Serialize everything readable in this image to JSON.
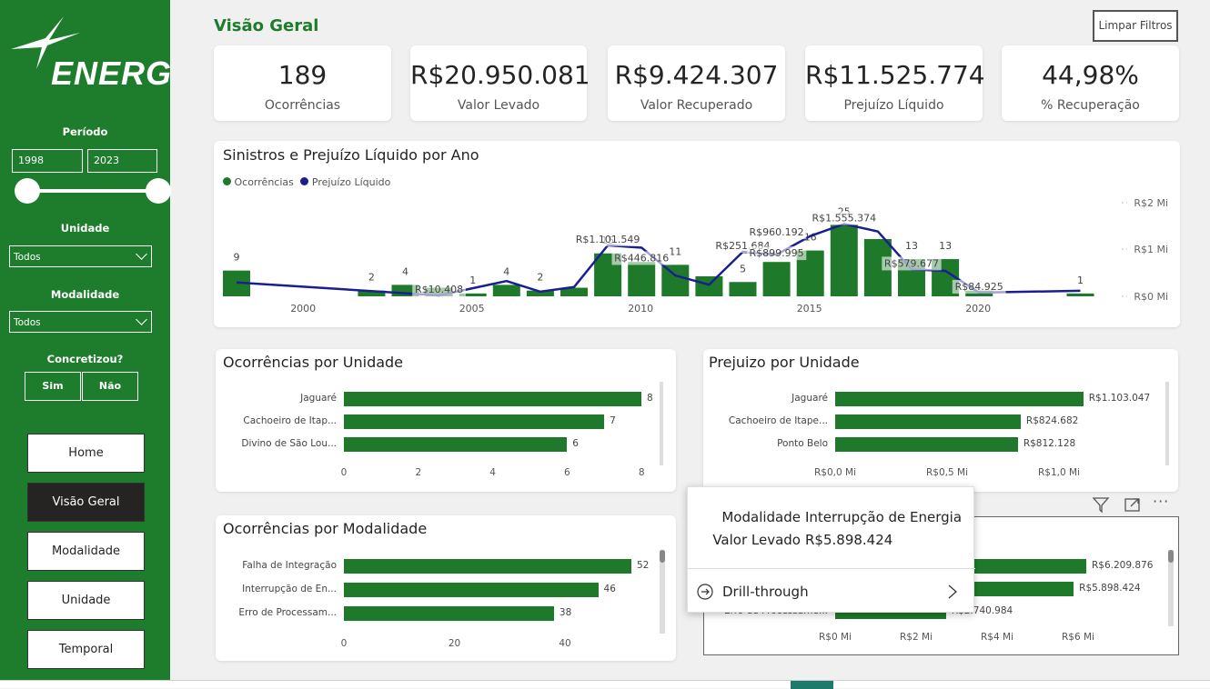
{
  "sidebar": {
    "logo": "ENERG",
    "periodo_label": "Período",
    "year_from": "1998",
    "year_to": "2023",
    "unidade_label": "Unidade",
    "unidade_value": "Todos",
    "modalidade_label": "Modalidade",
    "modalidade_value": "Todos",
    "concretizou_label": "Concretizou?",
    "sim": "Sim",
    "nao": "Não",
    "nav": [
      "Home",
      "Visão Geral",
      "Modalidade",
      "Unidade",
      "Temporal"
    ]
  },
  "header": {
    "title": "Visão Geral",
    "clear_filters": "Limpar Filtros"
  },
  "kpis": [
    {
      "value": "189",
      "label": "Ocorrências"
    },
    {
      "value": "R$20.950.081",
      "label": "Valor Levado"
    },
    {
      "value": "R$9.424.307",
      "label": "Valor Recuperado"
    },
    {
      "value": "R$11.525.774",
      "label": "Prejuízo Líquido"
    },
    {
      "value": "44,98%",
      "label": "% Recuperação"
    }
  ],
  "colors": {
    "green": "#1e7a2a",
    "navy": "#1a1f8f"
  },
  "chart_data": [
    {
      "type": "bar",
      "title": "Sinistros e Prejuízo Líquido por Ano",
      "legend": [
        "Ocorrências",
        "Prejuízo Líquido"
      ],
      "x_ticks": [
        "2000",
        "2005",
        "2010",
        "2015",
        "2020"
      ],
      "y2_ticks": [
        "R$2 Mi",
        "R$1 Mi",
        "R$0 Mi"
      ],
      "series": [
        {
          "name": "Ocorrências",
          "points": [
            [
              1998,
              9
            ],
            [
              2002,
              2
            ],
            [
              2003,
              4
            ],
            [
              2004,
              3
            ],
            [
              2005,
              1
            ],
            [
              2006,
              4
            ],
            [
              2007,
              2
            ],
            [
              2008,
              3
            ],
            [
              2009,
              15
            ],
            [
              2010,
              12
            ],
            [
              2011,
              11
            ],
            [
              2012,
              7
            ],
            [
              2013,
              5
            ],
            [
              2014,
              12
            ],
            [
              2015,
              16
            ],
            [
              2016,
              25
            ],
            [
              2017,
              20
            ],
            [
              2018,
              13
            ],
            [
              2019,
              13
            ],
            [
              2020,
              2
            ],
            [
              2023,
              1
            ]
          ]
        },
        {
          "name": "Prejuízo Líquido",
          "points": [
            [
              1998,
              0.3
            ],
            [
              2004,
              0.02
            ],
            [
              2006,
              0.33
            ],
            [
              2007,
              0.1
            ],
            [
              2008,
              0.2
            ],
            [
              2009,
              1.1
            ],
            [
              2010,
              1.05
            ],
            [
              2011,
              0.45
            ],
            [
              2012,
              0.25
            ],
            [
              2013,
              0.96
            ],
            [
              2014,
              0.9
            ],
            [
              2015,
              1.3
            ],
            [
              2016,
              1.56
            ],
            [
              2017,
              1.4
            ],
            [
              2018,
              0.58
            ],
            [
              2019,
              0.55
            ],
            [
              2020,
              0.08
            ],
            [
              2023,
              0.12
            ]
          ]
        }
      ],
      "bar_labels": [
        {
          "year": 1998,
          "text": "9"
        },
        {
          "year": 2002,
          "text": "2"
        },
        {
          "year": 2003,
          "text": "4"
        },
        {
          "year": 2005,
          "text": "1"
        },
        {
          "year": 2006,
          "text": "4"
        },
        {
          "year": 2007,
          "text": "2"
        },
        {
          "year": 2009,
          "text": "15"
        },
        {
          "year": 2011,
          "text": "11"
        },
        {
          "year": 2013,
          "text": "5"
        },
        {
          "year": 2015,
          "text": "16"
        },
        {
          "year": 2016,
          "text": "25"
        },
        {
          "year": 2018,
          "text": "13"
        },
        {
          "year": 2019,
          "text": "13"
        },
        {
          "year": 2023,
          "text": "1"
        }
      ],
      "line_labels": [
        {
          "year": 2004,
          "text": "R$10.408"
        },
        {
          "year": 2009,
          "text": "R$1.101.549"
        },
        {
          "year": 2010,
          "text": "R$446.816"
        },
        {
          "year": 2013,
          "text": "R$251.684"
        },
        {
          "year": 2014,
          "text": "R$960.192"
        },
        {
          "year": 2014,
          "text": "R$899.995"
        },
        {
          "year": 2016,
          "text": "R$1.555.374"
        },
        {
          "year": 2018,
          "text": "R$579.677"
        },
        {
          "year": 2020,
          "text": "R$84.925"
        }
      ]
    },
    {
      "type": "bar",
      "title": "Ocorrências por Unidade",
      "categories": [
        "Jaguaré",
        "Cachoeiro de Itap...",
        "Divino de São Lou..."
      ],
      "values": [
        8,
        7,
        6
      ],
      "xlim": [
        0,
        8
      ],
      "ticks": [
        "0",
        "2",
        "4",
        "6",
        "8"
      ]
    },
    {
      "type": "bar",
      "title": "Prejuizo por Unidade",
      "categories": [
        "Jaguaré",
        "Cachoeiro de Itape...",
        "Ponto Belo"
      ],
      "values": [
        1103047,
        824682,
        812128
      ],
      "value_labels": [
        "R$1.103.047",
        "R$824.682",
        "R$812.128"
      ],
      "xlim": [
        0,
        1100000
      ],
      "ticks": [
        "R$0,0 Mi",
        "R$0,5 Mi",
        "R$1,0 Mi"
      ]
    },
    {
      "type": "bar",
      "title": "Ocorrências por Modalidade",
      "categories": [
        "Falha de Integração",
        "Interrupção de En...",
        "Erro de Processam..."
      ],
      "values": [
        52,
        46,
        38
      ],
      "xlim": [
        0,
        52
      ],
      "ticks": [
        "0",
        "20",
        "40"
      ]
    },
    {
      "type": "bar",
      "title": "",
      "categories": [
        "",
        "",
        "Erro de Processame..."
      ],
      "values": [
        6209876,
        5898424,
        2740984
      ],
      "value_labels": [
        "R$6.209.876",
        "R$5.898.424",
        "R$2.740.984"
      ],
      "xlim": [
        0,
        6209876
      ],
      "ticks": [
        "R$0 Mi",
        "R$2 Mi",
        "R$4 Mi",
        "R$6 Mi"
      ]
    }
  ],
  "tooltip": {
    "k1": "Modalidade",
    "v1": "Interrupção de Energia",
    "k2": "Valor Levado",
    "v2": "R$5.898.424",
    "drill": "Drill-through"
  }
}
